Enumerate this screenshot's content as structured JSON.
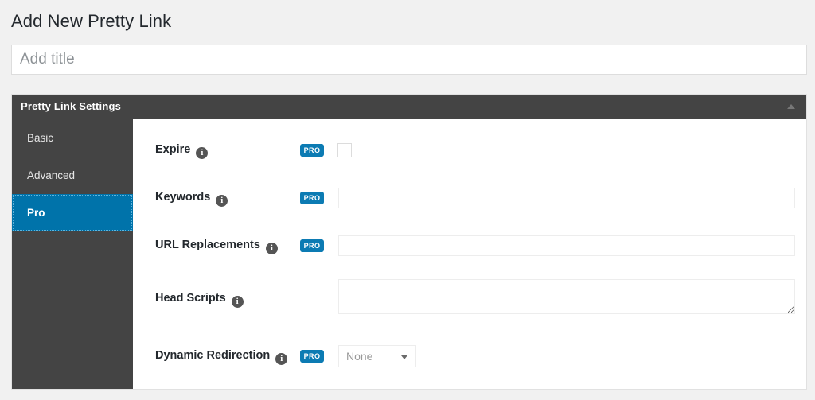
{
  "page": {
    "heading": "Add New Pretty Link"
  },
  "title_field": {
    "placeholder": "Add title",
    "value": ""
  },
  "panel": {
    "header_title": "Pretty Link Settings",
    "collapse_icon": "chevron-up-icon",
    "sidebar": {
      "items": [
        {
          "label": "Basic",
          "active": false
        },
        {
          "label": "Advanced",
          "active": false
        },
        {
          "label": "Pro",
          "active": true
        }
      ]
    },
    "rows": [
      {
        "label": "Expire",
        "info_icon": "info-icon",
        "pro_badge": "PRO",
        "has_pro": true,
        "control": "checkbox",
        "value": "",
        "checked": false
      },
      {
        "label": "Keywords",
        "info_icon": "info-icon",
        "pro_badge": "PRO",
        "has_pro": true,
        "control": "text",
        "value": "",
        "placeholder": ""
      },
      {
        "label": "URL Replacements",
        "info_icon": "info-icon",
        "pro_badge": "PRO",
        "has_pro": true,
        "control": "text",
        "value": "",
        "placeholder": ""
      },
      {
        "label": "Head Scripts",
        "info_icon": "info-icon",
        "pro_badge": "",
        "has_pro": false,
        "control": "textarea",
        "value": "",
        "placeholder": ""
      },
      {
        "label": "Dynamic Redirection",
        "info_icon": "info-icon",
        "pro_badge": "PRO",
        "has_pro": true,
        "control": "select",
        "value": "None",
        "options": [
          "None"
        ]
      }
    ]
  },
  "colors": {
    "page_background": "#f1f1f1",
    "panel_header": "#444444",
    "sidebar": "#444444",
    "accent_active": "#0073aa",
    "pro_badge": "#0c7bb3",
    "text_dark": "#23282d",
    "placeholder": "#8d9296"
  }
}
